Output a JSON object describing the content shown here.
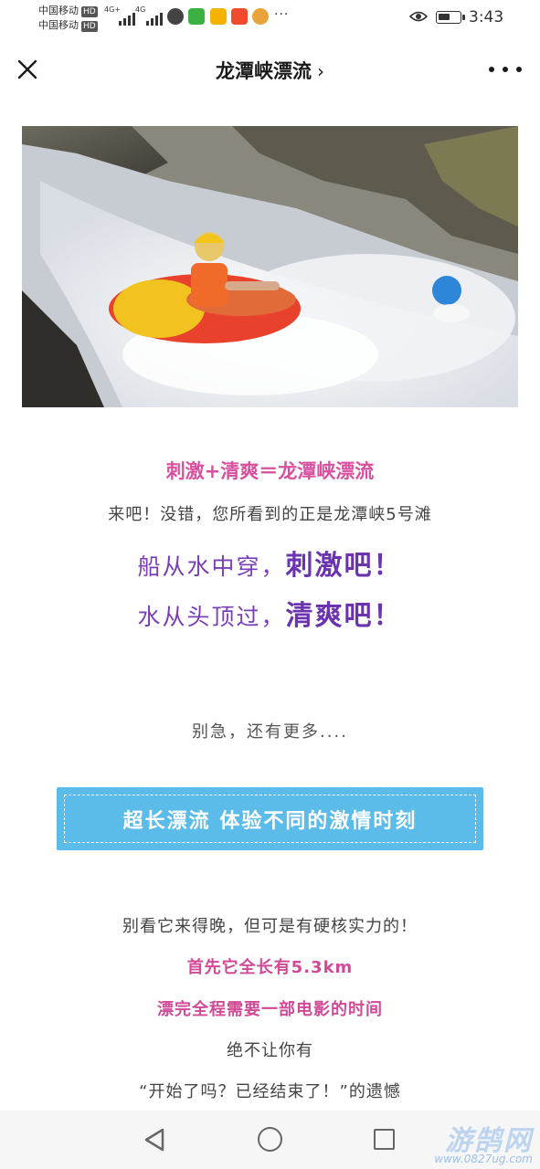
{
  "status_bar": {
    "carrier1": "中国移动",
    "carrier2": "中国移动",
    "hd_badge": "HD",
    "net1": "4G+",
    "net2": "4G",
    "ellipsis": "···",
    "time": "3:43",
    "battery_level": 0.55
  },
  "nav": {
    "title": "龙潭峡漂流",
    "chevron": "›"
  },
  "hero": {
    "icon": "rafting-photo"
  },
  "article": {
    "headline": "刺激+清爽＝龙潭峡漂流",
    "intro": "来吧！没错，您所看到的正是龙潭峡5号滩",
    "slogan1_a": "船从水中穿，",
    "slogan1_b": "刺激吧！",
    "slogan2_a": "水从头顶过，",
    "slogan2_b": "清爽吧！",
    "wait": "别急，还有更多....",
    "banner": "超长漂流 体验不同的激情时刻",
    "p1": "别看它来得晚，但可是有硬核实力的！",
    "p2": "首先它全长有5.3km",
    "p3": "漂完全程需要一部电影的时间",
    "p4": "绝不让你有",
    "p5": "“开始了吗？已经结束了！”的遗憾"
  },
  "watermark": {
    "brand": "游鹄网",
    "url": "www.0827ug.com"
  },
  "colors": {
    "accent_pink": "#d94f9e",
    "accent_purple": "#6b33b0",
    "banner_blue": "#5bbbe9"
  }
}
